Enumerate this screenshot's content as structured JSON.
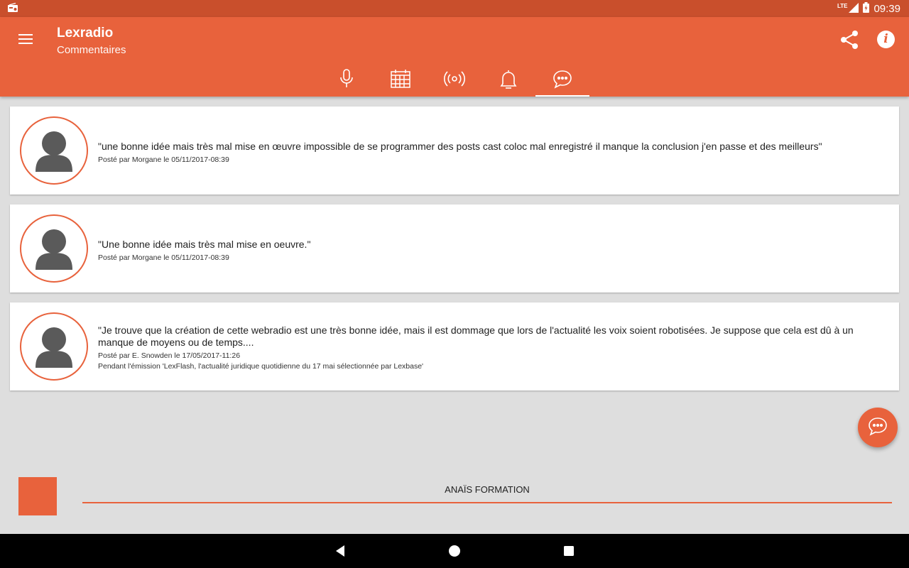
{
  "status_bar": {
    "network": "LTE",
    "time": "09:39",
    "left_icon": "radio-icon",
    "battery_icon": "battery-charging-icon"
  },
  "app_bar": {
    "title": "Lexradio",
    "subtitle": "Commentaires",
    "menu_icon": "hamburger-menu-icon",
    "share_icon": "share-icon",
    "info_label": "i"
  },
  "tabs": [
    {
      "icon": "microphone-icon",
      "active": false
    },
    {
      "icon": "calendar-icon",
      "active": false
    },
    {
      "icon": "broadcast-icon",
      "active": false
    },
    {
      "icon": "bell-icon",
      "active": false
    },
    {
      "icon": "chat-icon",
      "active": true
    }
  ],
  "comments": [
    {
      "text": "\"une bonne idée mais très mal mise en œuvre impossible de se programmer des posts cast coloc mal enregistré il manque la conclusion j'en passe et des meilleurs\"",
      "meta": "Posté par Morgane le 05/11/2017-08:39",
      "emission": ""
    },
    {
      "text": "\"Une bonne idée mais très mal mise en oeuvre.\"",
      "meta": "Posté par Morgane le 05/11/2017-08:39",
      "emission": ""
    },
    {
      "text": "\"Je trouve que la création de cette webradio est une très  bonne idée, mais il est dommage que lors de l'actualité les voix soient robotisées. Je suppose que cela est dû à un manque de moyens ou de temps....",
      "meta": "Posté par E. Snowden  le 17/05/2017-11:26",
      "emission": "Pendant l'émission 'LexFlash, l'actualité juridique quotidienne du 17 mai sélectionnée par Lexbase'"
    }
  ],
  "fab": {
    "icon": "chat-icon"
  },
  "player": {
    "title": "ANAÏS FORMATION"
  },
  "nav": {
    "back": "back-icon",
    "home": "home-icon",
    "recents": "recents-icon"
  },
  "colors": {
    "accent": "#e8623c",
    "status_bar": "#c94f2c",
    "background": "#dedede"
  }
}
